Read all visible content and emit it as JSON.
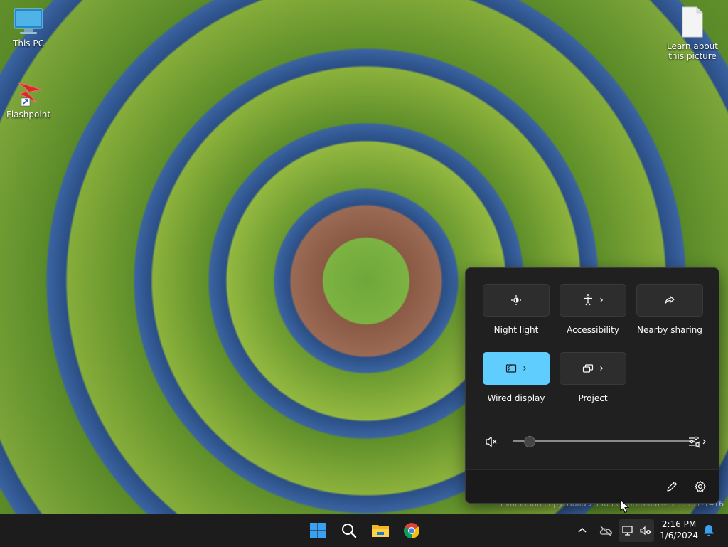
{
  "desktop": {
    "icons": [
      {
        "label": "This PC",
        "icon": "monitor-icon"
      },
      {
        "label": "Flashpoint",
        "icon": "flashpoint-shortcut-icon"
      },
      {
        "label": "Learn about this picture",
        "icon": "document-icon"
      }
    ],
    "watermark": "Evaluation copy. Build 25905.rs_prerelease.230901-1416"
  },
  "quick_settings": {
    "tiles": [
      {
        "label": "Night light",
        "icon": "night-light-icon",
        "active": false,
        "has_chevron": false
      },
      {
        "label": "Accessibility",
        "icon": "accessibility-icon",
        "active": false,
        "has_chevron": true
      },
      {
        "label": "Nearby sharing",
        "icon": "share-icon",
        "active": false,
        "has_chevron": false
      },
      {
        "label": "Wired display",
        "icon": "cast-icon",
        "active": true,
        "has_chevron": true
      },
      {
        "label": "Project",
        "icon": "project-icon",
        "active": false,
        "has_chevron": true
      }
    ],
    "volume": {
      "level": 0,
      "muted": true
    },
    "accent_color": "#60cdff"
  },
  "taskbar": {
    "apps": [
      "start-icon",
      "search-icon",
      "file-explorer-icon",
      "chrome-icon"
    ],
    "tray": [
      "chevron-up-icon",
      "onedrive-icon",
      "network-icon",
      "volume-muted-icon"
    ],
    "time": "2:16 PM",
    "date": "1/6/2024"
  }
}
